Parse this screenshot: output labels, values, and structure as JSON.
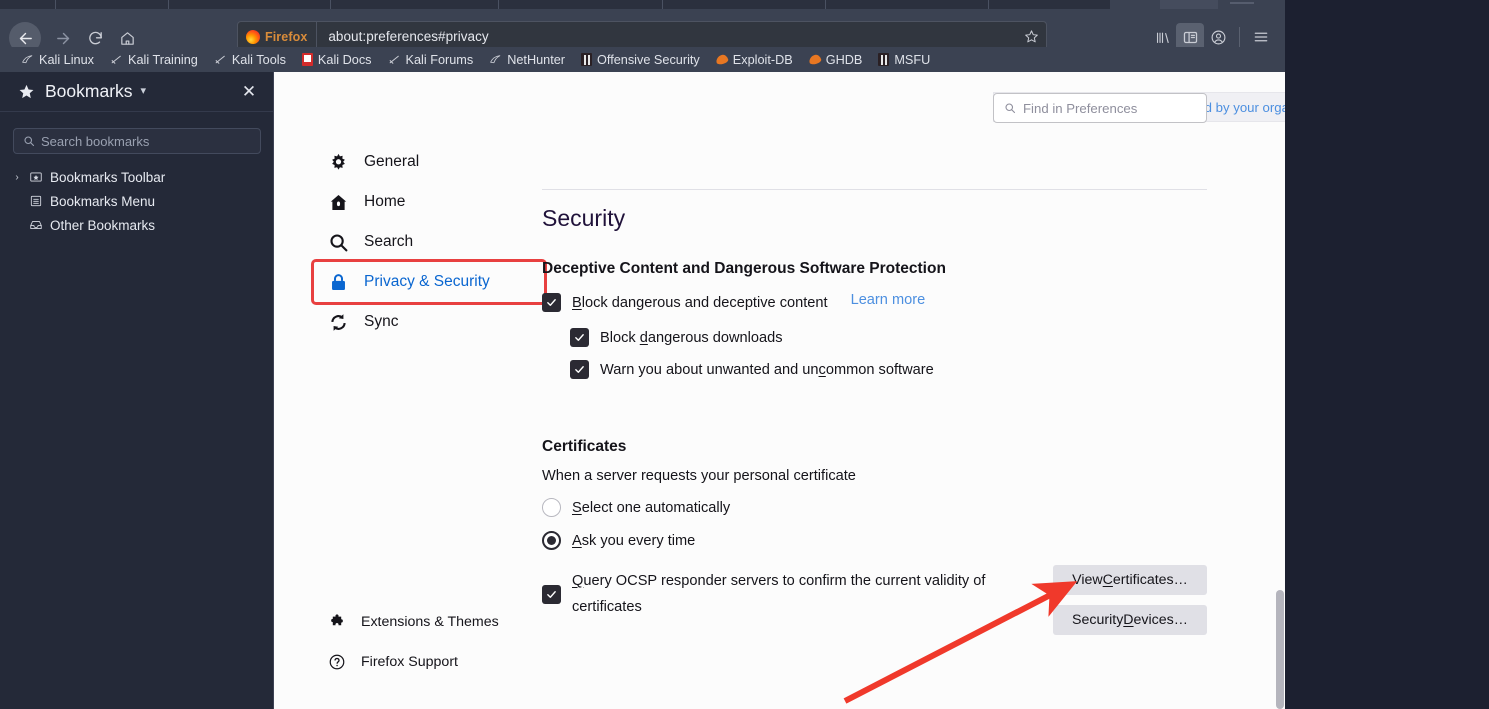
{
  "window": {
    "title": "Firefox — about:preferences#privacy"
  },
  "toolbar": {
    "back_icon": "back-arrow-icon",
    "forward_icon": "forward-arrow-icon",
    "reload_icon": "reload-icon",
    "home_icon": "home-icon",
    "identity_label": "Firefox",
    "url": "about:preferences#privacy",
    "star_icon": "bookmark-star-icon",
    "library_icon": "library-icon",
    "sidebar_icon": "sidebar-toggle-icon",
    "account_icon": "account-icon",
    "menu_icon": "hamburger-menu-icon"
  },
  "bookmarks_toolbar": {
    "items": [
      {
        "label": "Kali Linux",
        "icon": "kali-dragon-icon"
      },
      {
        "label": "Kali Training",
        "icon": "kali-sword-icon"
      },
      {
        "label": "Kali Tools",
        "icon": "kali-sword-icon"
      },
      {
        "label": "Kali Docs",
        "icon": "kali-docs-icon"
      },
      {
        "label": "Kali Forums",
        "icon": "kali-sword-icon"
      },
      {
        "label": "NetHunter",
        "icon": "kali-dragon-icon"
      },
      {
        "label": "Offensive Security",
        "icon": "offsec-icon"
      },
      {
        "label": "Exploit-DB",
        "icon": "flame-icon"
      },
      {
        "label": "GHDB",
        "icon": "flame-icon"
      },
      {
        "label": "MSFU",
        "icon": "offsec-icon"
      }
    ]
  },
  "sidebar": {
    "title": "Bookmarks",
    "star_icon": "star-icon",
    "caret_icon": "chevron-down-icon",
    "close_icon": "close-icon",
    "search_placeholder": "Search bookmarks",
    "search_icon": "search-icon",
    "tree": [
      {
        "label": "Bookmarks Toolbar",
        "icon": "toolbar-folder-icon",
        "twisty": "›"
      },
      {
        "label": "Bookmarks Menu",
        "icon": "menu-folder-icon",
        "twisty": ""
      },
      {
        "label": "Other Bookmarks",
        "icon": "tray-folder-icon",
        "twisty": ""
      }
    ]
  },
  "preferences": {
    "notification": {
      "icon": "info-icon",
      "text": "Your browser is being managed by your organization."
    },
    "find": {
      "placeholder": "Find in Preferences",
      "icon": "search-icon",
      "value": ""
    },
    "categories": [
      {
        "label": "General",
        "icon": "gear-icon",
        "selected": false
      },
      {
        "label": "Home",
        "icon": "home-icon",
        "selected": false
      },
      {
        "label": "Search",
        "icon": "search-icon",
        "selected": false
      },
      {
        "label": "Privacy & Security",
        "icon": "lock-icon",
        "selected": true
      },
      {
        "label": "Sync",
        "icon": "sync-icon",
        "selected": false
      }
    ],
    "footer_links": [
      {
        "label": "Extensions & Themes",
        "icon": "puzzle-icon"
      },
      {
        "label": "Firefox Support",
        "icon": "question-circle-icon"
      }
    ],
    "section_title": "Security",
    "deceptive": {
      "heading": "Deceptive Content and Dangerous Software Protection",
      "block_label_pre": "B",
      "block_label_post": "lock dangerous and deceptive content",
      "learn_more": "Learn more",
      "block_checked": true,
      "downloads_label_pre": "Block ",
      "downloads_label_ak": "d",
      "downloads_label_post": "angerous downloads",
      "downloads_checked": true,
      "unwanted_label_pre": "Warn you about unwanted and un",
      "unwanted_label_ak": "c",
      "unwanted_label_post": "ommon software",
      "unwanted_checked": true
    },
    "certificates": {
      "heading": "Certificates",
      "subtitle": "When a server requests your personal certificate",
      "auto_label_ak": "S",
      "auto_label_post": "elect one automatically",
      "auto_selected": false,
      "ask_label_ak": "A",
      "ask_label_post": "sk you every time",
      "ask_selected": true,
      "ocsp_label_ak": "Q",
      "ocsp_label_post": "uery OCSP responder servers to confirm the current validity of",
      "ocsp_label_line2": "certificates",
      "ocsp_checked": true,
      "view_certificates_pre": "View ",
      "view_certificates_ak": "C",
      "view_certificates_post": "ertificates…",
      "security_devices_pre": "Security ",
      "security_devices_ak": "D",
      "security_devices_post": "evices…"
    }
  },
  "annotation": {
    "arrow_color": "#f0392b",
    "highlight_color": "#e84040",
    "arrow_target": "view-certificates-button"
  }
}
